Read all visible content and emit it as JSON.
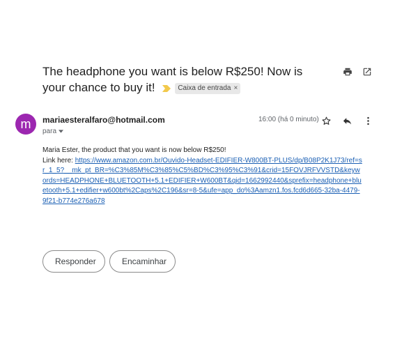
{
  "email": {
    "subject": "The headphone you want is below R$250! Now is your chance to buy it!",
    "label": "Caixa de entrada",
    "label_remove": "×",
    "sender_email": "mariaesteralfaro@hotmail.com",
    "avatar_letter": "m",
    "to_label": "para",
    "time": "16:00 (há 0 minuto)",
    "body_line1": "Maria Ester, the product that you want is now below R$250!",
    "link_prefix": "Link here: ",
    "link_url": "https://www.amazon.com.br/Ouvido-Headset-EDIFIER-W800BT-PLUS/dp/B08P2K1J73/ref=sr_1_5?__mk_pt_BR=%C3%85M%C3%85%C5%BD%C3%95%C3%91&crid=15FOVJRFVVSTD&keywords=HEADPHONE+BLUETOOTH+5.1+EDIFIER+W600BT&qid=1662992440&sprefix=headphone+bluetooth+5.1+edifier+w600bt%2Caps%2C196&sr=8-5&ufe=app_do%3Aamzn1.fos.fcd6d665-32ba-4479-9f21-b774e276a678"
  },
  "actions": {
    "reply_label": "Responder",
    "forward_label": "Encaminhar"
  },
  "colors": {
    "avatar_bg": "#9c27b0",
    "importance": "#f2c94c",
    "link": "#1a5fb4"
  },
  "icons": [
    "print-icon",
    "open-in-new-icon",
    "star-icon",
    "reply-icon",
    "more-vert-icon",
    "importance-icon",
    "chevron-down-icon",
    "forward-icon"
  ]
}
